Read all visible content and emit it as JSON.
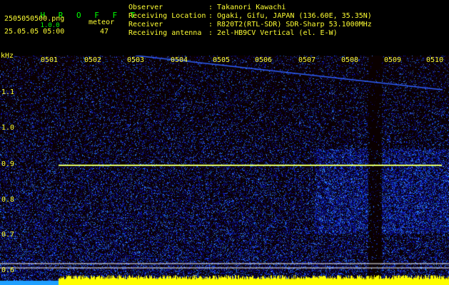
{
  "header": {
    "app_name": "H R O F F T",
    "version": "1.0.0",
    "filename": "2505050500.png",
    "datetime": "25.05.05 05:00",
    "meteor_label": "meteor",
    "meteor_count": "47",
    "observer_label": "Observer",
    "observer_value": ": Takanori Kawachi",
    "location_label": "Receiving Location",
    "location_value": ": Ogaki, Gifu, JAPAN (136.60E, 35.35N)",
    "receiver_label": "Receiver",
    "receiver_value": ": R820T2(RTL-SDR) SDR-Sharp 53.1000MHz",
    "antenna_label": "Receiving antenna",
    "antenna_value": ": 2el-HB9CV Vertical (el. E-W)"
  },
  "axis": {
    "unit": "kHz",
    "freq_ticks": [
      "1.1",
      "1.0",
      "0.9",
      "0.8",
      "0.7",
      "0.6"
    ],
    "time_ticks": [
      "0501",
      "0502",
      "0503",
      "0504",
      "0505",
      "0506",
      "0507",
      "0508",
      "0509",
      "0510"
    ]
  },
  "colors": {
    "background": "#000000",
    "label_green": "#00ff00",
    "label_yellow": "#ffff33",
    "carrier_line": "#e6ff66",
    "spectrum_blue": "#1030c0"
  }
}
